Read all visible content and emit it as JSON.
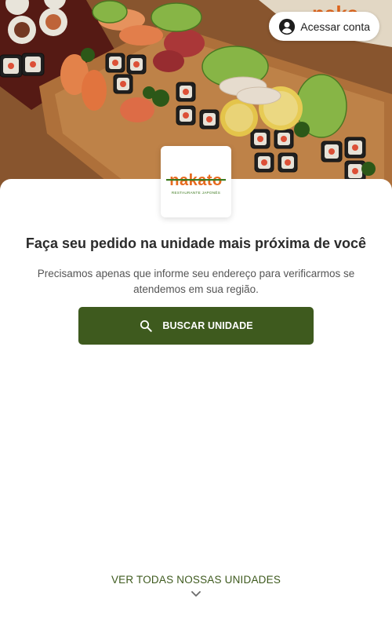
{
  "header": {
    "account_label": "Acessar conta",
    "account_icon": "account-circle-icon"
  },
  "brand": {
    "name": "nakato",
    "tagline": "RESTAURANTE JAPONÊS",
    "colors": {
      "primary": "#3e5a1e",
      "orange": "#e86a1f",
      "green": "#3d7a1f"
    }
  },
  "main": {
    "headline": "Faça seu pedido na unidade mais próxima de você",
    "subtext": "Precisamos apenas que informe seu endereço para verificarmos se atendemos em sua região.",
    "cta_label": "BUSCAR UNIDADE",
    "cta_icon": "search-icon"
  },
  "footer": {
    "all_units_label": "VER TODAS NOSSAS UNIDADES",
    "all_units_icon": "chevron-down-icon"
  },
  "hero_image": {
    "subject": "sushi platter",
    "partial_brand_text": "naka"
  }
}
